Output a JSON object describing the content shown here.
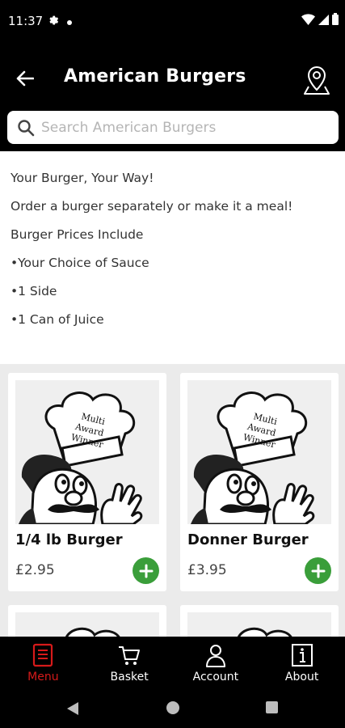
{
  "status_bar": {
    "time": "11:37"
  },
  "app_bar": {
    "title": "American Burgers"
  },
  "search": {
    "placeholder": "Search American Burgers",
    "value": ""
  },
  "description": {
    "lines": [
      "Your Burger, Your Way!",
      "Order a burger separately or make it a meal!",
      "Burger Prices Include",
      "•Your Choice of Sauce",
      "•1 Side",
      "•1 Can of Juice"
    ]
  },
  "products": [
    {
      "name": "1/4 lb Burger",
      "price": "£2.95",
      "badge_text": [
        "Multi",
        "Award",
        "Winner"
      ]
    },
    {
      "name": "Donner Burger",
      "price": "£3.95",
      "badge_text": [
        "Multi",
        "Award",
        "Winner"
      ]
    }
  ],
  "bottom_nav": {
    "items": [
      {
        "label": "Menu",
        "icon": "menu-icon",
        "active": true
      },
      {
        "label": "Basket",
        "icon": "basket-icon",
        "active": false
      },
      {
        "label": "Account",
        "icon": "account-icon",
        "active": false
      },
      {
        "label": "About",
        "icon": "info-icon",
        "active": false
      }
    ]
  },
  "colors": {
    "accent_active": "#d61a1a",
    "add_button": "#3a9e3a",
    "background": "#000000"
  }
}
